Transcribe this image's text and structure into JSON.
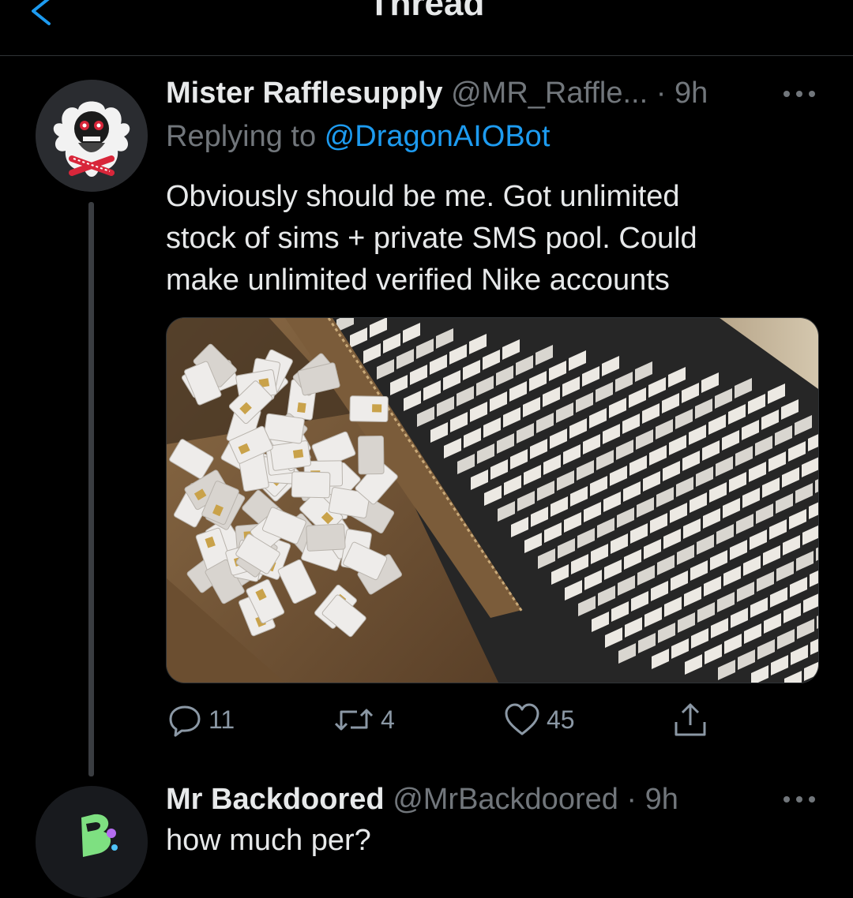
{
  "header": {
    "title": "Thread"
  },
  "tweet1": {
    "display_name": "Mister Rafflesupply",
    "handle": "@MR_Raffle...",
    "separator": " · ",
    "time": "9h",
    "replying_prefix": "Replying to ",
    "replying_to": "@DragonAIOBot",
    "text_lines": [
      "Obviously should be me. Got unlimited",
      "stock of sims + private SMS pool. Could",
      "make unlimited verified Nike accounts"
    ],
    "actions": {
      "replies": "11",
      "retweets": "4",
      "likes": "45"
    }
  },
  "tweet2": {
    "display_name": "Mr Backdoored",
    "handle": "@MrBackdoored",
    "separator": " · ",
    "time": "9h",
    "text": "how much per?"
  },
  "icons": {
    "back": "chevron-left-icon",
    "more": "more-horizontal-icon",
    "reply": "comment-icon",
    "retweet": "retweet-icon",
    "like": "heart-icon",
    "share": "share-icon"
  },
  "colors": {
    "background": "#000000",
    "accent": "#1d9bf0",
    "secondary_text": "#71767b",
    "primary_text": "#e7e9ea"
  }
}
